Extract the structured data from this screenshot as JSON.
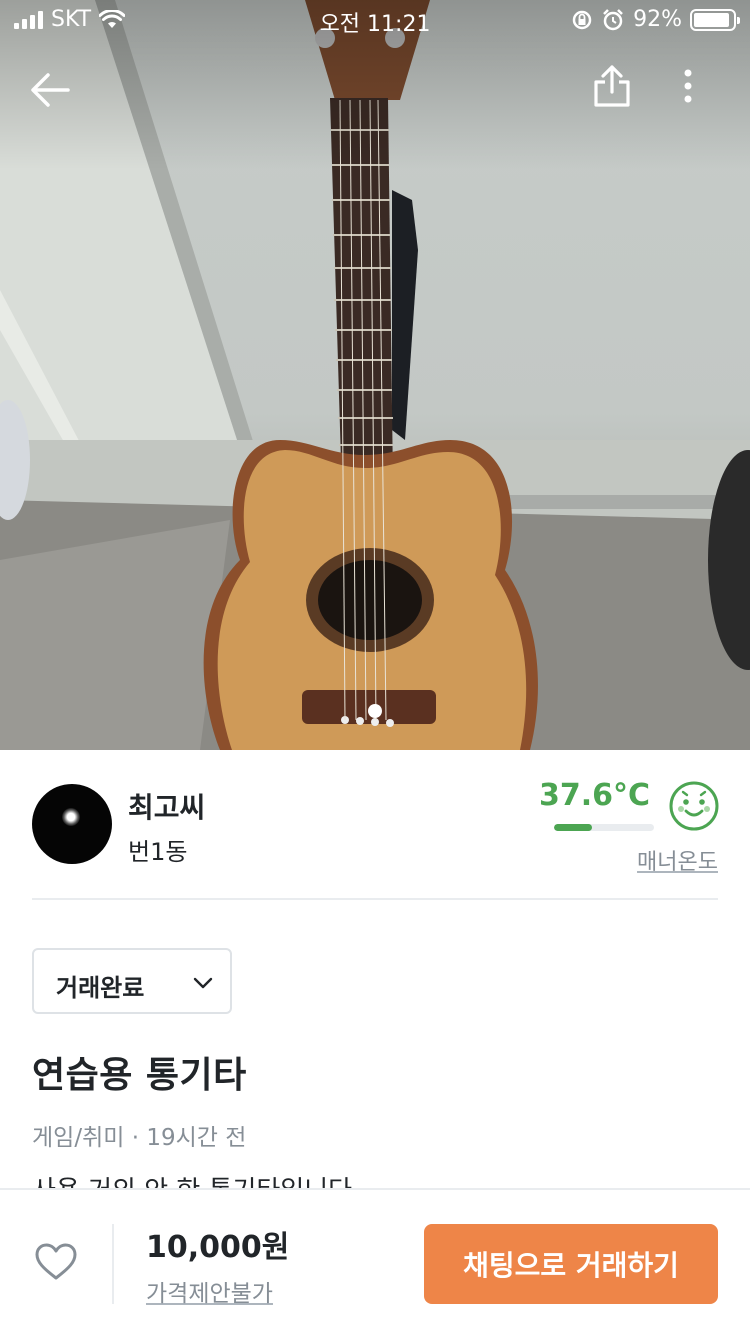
{
  "status_bar": {
    "carrier": "SKT",
    "time": "오전 11:21",
    "battery_percent": "92%",
    "battery_level": 0.92
  },
  "nav": {
    "back_icon": "arrow-left-icon",
    "share_icon": "share-icon",
    "more_icon": "more-vertical-icon"
  },
  "photo": {
    "description_icon": "guitar-photo",
    "page_indicator_count": 1
  },
  "seller": {
    "name": "최고씨",
    "location": "번1동",
    "temperature": "37.6°C",
    "temperature_level": 0.376,
    "manner_label": "매너온도",
    "face_icon": "smile-face-icon"
  },
  "listing": {
    "status": "거래완료",
    "title": "연습용 통기타",
    "category": "게임/취미",
    "separator": " · ",
    "posted": "19시간 전",
    "description_preview": "사용 거의 안 한 통기타입니다"
  },
  "bottom_bar": {
    "like_icon": "heart-icon",
    "price": "10,000원",
    "negotiation": "가격제안불가",
    "chat_button": "채팅으로 거래하기"
  },
  "colors": {
    "accent": "#ee8548",
    "temperature_green": "#4ca552",
    "muted_text": "#868e96"
  }
}
